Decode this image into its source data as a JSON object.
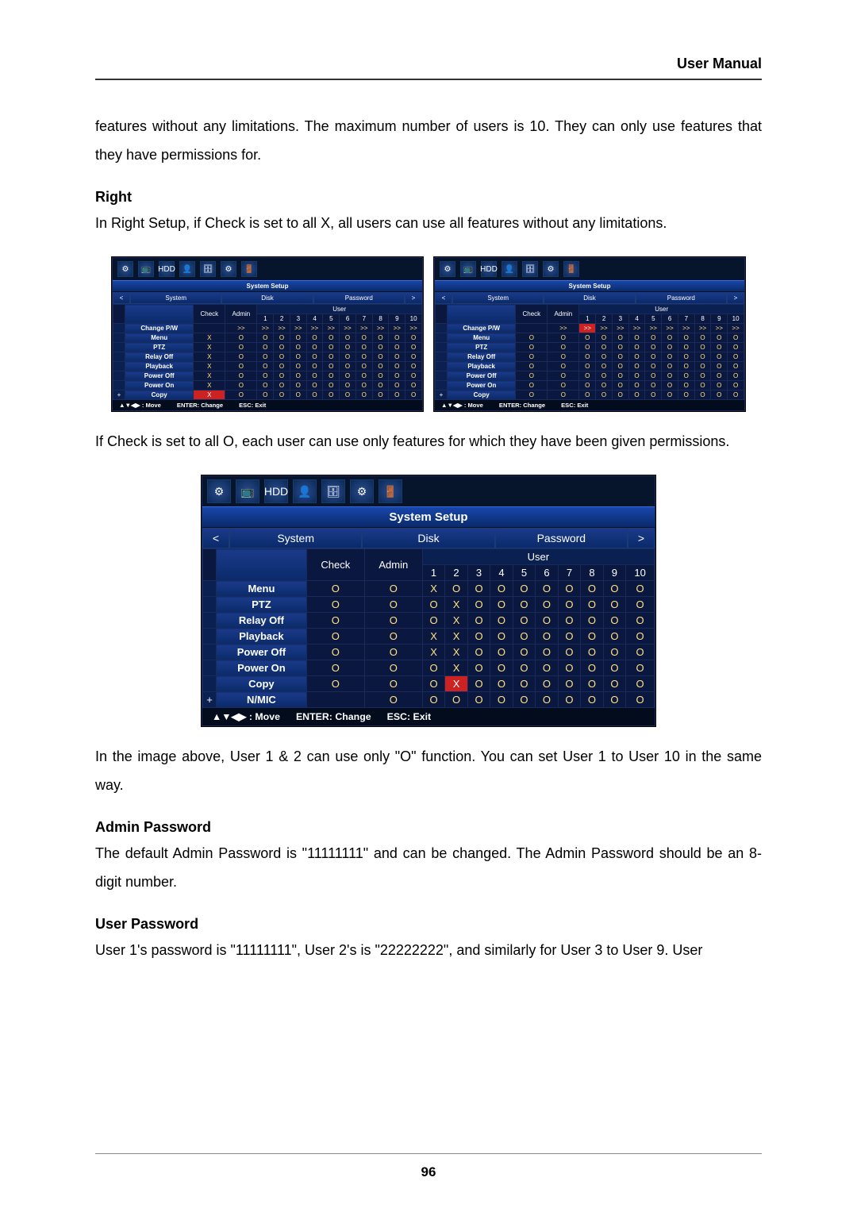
{
  "header": {
    "title": "User Manual"
  },
  "paras": {
    "intro": "features without any limitations. The maximum number of users is 10. They can only use features that they have permissions for.",
    "right_h": "Right",
    "right_p": "In Right Setup, if Check is set to all X, all users can use all features without any limitations.",
    "mid_p": "If Check is set to all O, each user can use only features for which they have been given permissions.",
    "below_large": "In the image above, User 1 & 2 can use only \"O\" function. You can set User 1 to User 10 in the same way.",
    "admin_h": "Admin Password",
    "admin_p": "The default Admin Password is \"11111111\" and can be changed. The Admin Password should be an 8-digit number.",
    "user_h": "User Password",
    "user_p": "User 1's password is \"11111111\", User 2's is \"22222222\", and similarly for User 3 to User 9. User"
  },
  "dvr_common": {
    "title": "System Setup",
    "tabs": {
      "t1": "System",
      "t2": "Disk",
      "t3": "Password"
    },
    "cols": {
      "check": "Check",
      "admin": "Admin",
      "user": "User"
    },
    "footer": {
      "move": "▲▼◀▶ : Move",
      "enter": "ENTER: Change",
      "esc": "ESC: Exit"
    },
    "arrows": {
      "left": "<",
      "right": ">"
    },
    "icons": [
      "⚙",
      "📺",
      "HDD",
      "👤",
      "🗄",
      "⚙",
      "🚪"
    ]
  },
  "dvr1_rows": [
    {
      "label": "Change P/W",
      "check": "",
      "admin": ">>",
      "u": [
        ">>",
        ">>",
        ">>",
        ">>",
        ">>",
        ">>",
        ">>",
        ">>",
        ">>",
        ">>"
      ]
    },
    {
      "label": "Menu",
      "check": "X",
      "admin": "O",
      "u": [
        "O",
        "O",
        "O",
        "O",
        "O",
        "O",
        "O",
        "O",
        "O",
        "O"
      ]
    },
    {
      "label": "PTZ",
      "check": "X",
      "admin": "O",
      "u": [
        "O",
        "O",
        "O",
        "O",
        "O",
        "O",
        "O",
        "O",
        "O",
        "O"
      ]
    },
    {
      "label": "Relay Off",
      "check": "X",
      "admin": "O",
      "u": [
        "O",
        "O",
        "O",
        "O",
        "O",
        "O",
        "O",
        "O",
        "O",
        "O"
      ]
    },
    {
      "label": "Playback",
      "check": "X",
      "admin": "O",
      "u": [
        "O",
        "O",
        "O",
        "O",
        "O",
        "O",
        "O",
        "O",
        "O",
        "O"
      ]
    },
    {
      "label": "Power Off",
      "check": "X",
      "admin": "O",
      "u": [
        "O",
        "O",
        "O",
        "O",
        "O",
        "O",
        "O",
        "O",
        "O",
        "O"
      ]
    },
    {
      "label": "Power On",
      "check": "X",
      "admin": "O",
      "u": [
        "O",
        "O",
        "O",
        "O",
        "O",
        "O",
        "O",
        "O",
        "O",
        "O"
      ]
    },
    {
      "label": "Copy",
      "check": "X",
      "admin": "O",
      "u": [
        "O",
        "O",
        "O",
        "O",
        "O",
        "O",
        "O",
        "O",
        "O",
        "O"
      ],
      "hlCheck": true
    }
  ],
  "dvr2_rows": [
    {
      "label": "Change P/W",
      "check": "",
      "admin": ">>",
      "u": [
        ">>",
        ">>",
        ">>",
        ">>",
        ">>",
        ">>",
        ">>",
        ">>",
        ">>",
        ">>"
      ],
      "hl1": true
    },
    {
      "label": "Menu",
      "check": "O",
      "admin": "O",
      "u": [
        "O",
        "O",
        "O",
        "O",
        "O",
        "O",
        "O",
        "O",
        "O",
        "O"
      ]
    },
    {
      "label": "PTZ",
      "check": "O",
      "admin": "O",
      "u": [
        "O",
        "O",
        "O",
        "O",
        "O",
        "O",
        "O",
        "O",
        "O",
        "O"
      ]
    },
    {
      "label": "Relay Off",
      "check": "O",
      "admin": "O",
      "u": [
        "O",
        "O",
        "O",
        "O",
        "O",
        "O",
        "O",
        "O",
        "O",
        "O"
      ]
    },
    {
      "label": "Playback",
      "check": "O",
      "admin": "O",
      "u": [
        "O",
        "O",
        "O",
        "O",
        "O",
        "O",
        "O",
        "O",
        "O",
        "O"
      ]
    },
    {
      "label": "Power Off",
      "check": "O",
      "admin": "O",
      "u": [
        "O",
        "O",
        "O",
        "O",
        "O",
        "O",
        "O",
        "O",
        "O",
        "O"
      ]
    },
    {
      "label": "Power On",
      "check": "O",
      "admin": "O",
      "u": [
        "O",
        "O",
        "O",
        "O",
        "O",
        "O",
        "O",
        "O",
        "O",
        "O"
      ]
    },
    {
      "label": "Copy",
      "check": "O",
      "admin": "O",
      "u": [
        "O",
        "O",
        "O",
        "O",
        "O",
        "O",
        "O",
        "O",
        "O",
        "O"
      ]
    }
  ],
  "dvr3_rows": [
    {
      "label": "Menu",
      "check": "O",
      "admin": "O",
      "u": [
        "X",
        "O",
        "O",
        "O",
        "O",
        "O",
        "O",
        "O",
        "O",
        "O"
      ]
    },
    {
      "label": "PTZ",
      "check": "O",
      "admin": "O",
      "u": [
        "O",
        "X",
        "O",
        "O",
        "O",
        "O",
        "O",
        "O",
        "O",
        "O"
      ]
    },
    {
      "label": "Relay Off",
      "check": "O",
      "admin": "O",
      "u": [
        "O",
        "X",
        "O",
        "O",
        "O",
        "O",
        "O",
        "O",
        "O",
        "O"
      ]
    },
    {
      "label": "Playback",
      "check": "O",
      "admin": "O",
      "u": [
        "X",
        "X",
        "O",
        "O",
        "O",
        "O",
        "O",
        "O",
        "O",
        "O"
      ]
    },
    {
      "label": "Power Off",
      "check": "O",
      "admin": "O",
      "u": [
        "X",
        "X",
        "O",
        "O",
        "O",
        "O",
        "O",
        "O",
        "O",
        "O"
      ]
    },
    {
      "label": "Power On",
      "check": "O",
      "admin": "O",
      "u": [
        "O",
        "X",
        "O",
        "O",
        "O",
        "O",
        "O",
        "O",
        "O",
        "O"
      ]
    },
    {
      "label": "Copy",
      "check": "O",
      "admin": "O",
      "u": [
        "O",
        "X",
        "O",
        "O",
        "O",
        "O",
        "O",
        "O",
        "O",
        "O"
      ],
      "hl2": true
    },
    {
      "label": "N/MIC",
      "check": "",
      "admin": "O",
      "u": [
        "O",
        "O",
        "O",
        "O",
        "O",
        "O",
        "O",
        "O",
        "O",
        "O"
      ]
    }
  ],
  "page_number": "96"
}
